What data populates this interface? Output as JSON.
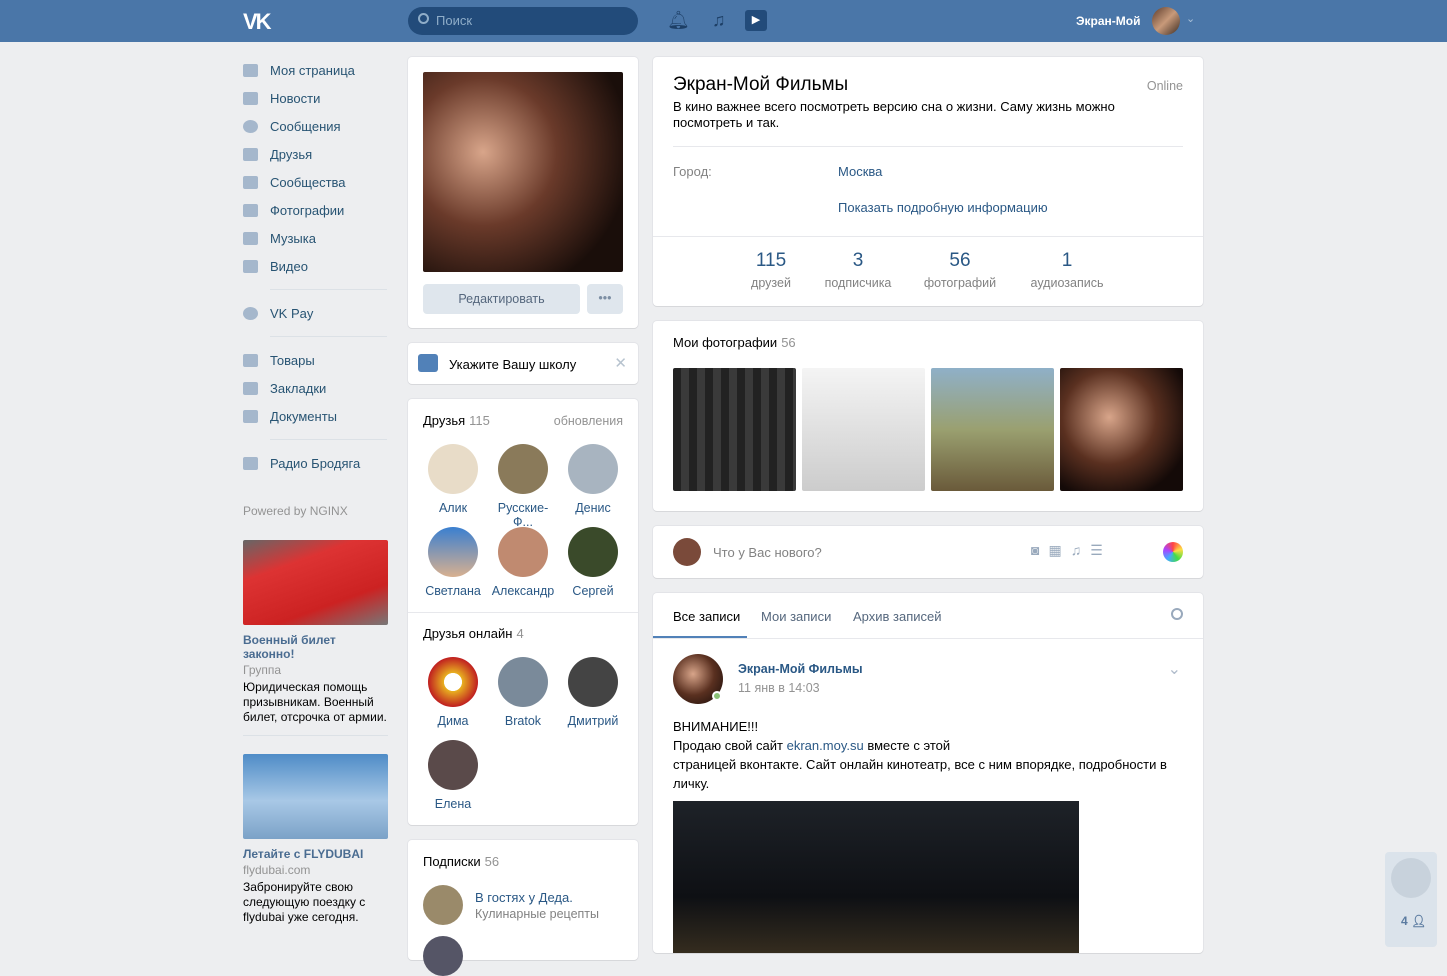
{
  "header": {
    "logo": "VK",
    "search_placeholder": "Поиск",
    "user_name": "Экран-Мой"
  },
  "nav": {
    "items": [
      "Моя страница",
      "Новости",
      "Сообщения",
      "Друзья",
      "Сообщества",
      "Фотографии",
      "Музыка",
      "Видео"
    ],
    "items2": [
      "VK Pay"
    ],
    "items3": [
      "Товары",
      "Закладки",
      "Документы"
    ],
    "items4": [
      "Радио Бродяга"
    ]
  },
  "powered": "Powered by NGINX",
  "ads": [
    {
      "title": "Военный билет законно!",
      "sub": "Группа",
      "desc": "Юридическая помощь призывникам. Военный билет, отсрочка от армии."
    },
    {
      "title": "Летайте с FLYDUBAI",
      "sub": "flydubai.com",
      "desc": "Забронируйте свою следующую поездку с flydubai уже сегодня."
    }
  ],
  "profile": {
    "edit": "Редактировать",
    "more": "•••",
    "school": "Укажите Вашу школу",
    "name": "Экран-Мой Фильмы",
    "status_online": "Online",
    "status": "В кино важнее всего посмотреть версию сна о жизни. Саму жизнь можно посмотреть и так.",
    "city_label": "Город:",
    "city": "Москва",
    "more_info": "Показать подробную информацию",
    "stats": [
      {
        "n": "115",
        "l": "друзей"
      },
      {
        "n": "3",
        "l": "подписчика"
      },
      {
        "n": "56",
        "l": "фотографий"
      },
      {
        "n": "1",
        "l": "аудиозапись"
      }
    ]
  },
  "friends": {
    "title": "Друзья",
    "count": "115",
    "updates": "обновления",
    "list": [
      "Алик",
      "Русские-Ф...",
      "Денис",
      "Светлана",
      "Александр",
      "Сергей"
    ],
    "online_title": "Друзья онлайн",
    "online_count": "4",
    "online": [
      "Дима",
      "Bratok",
      "Дмитрий",
      "Елена"
    ]
  },
  "subs": {
    "title": "Подписки",
    "count": "56",
    "items": [
      {
        "name": "В гостях у Деда.",
        "desc": "Кулинарные рецепты"
      }
    ]
  },
  "photos": {
    "title": "Мои фотографии",
    "count": "56"
  },
  "composer": {
    "placeholder": "Что у Вас нового?"
  },
  "wall": {
    "tabs": [
      "Все записи",
      "Мои записи",
      "Архив записей"
    ],
    "post": {
      "author": "Экран-Мой Фильмы",
      "date": "11 янв в 14:03",
      "l1": "ВНИМАНИЕ!!!",
      "l2a": "Продаю свой сайт ",
      "link": "ekran.moy.su",
      "l2b": " вместе с этой",
      "l3": "страницей вконтакте. Сайт онлайн кинотеатр, все с ним впорядке, подробности в личку."
    }
  },
  "chat_widget": {
    "count": "4"
  }
}
